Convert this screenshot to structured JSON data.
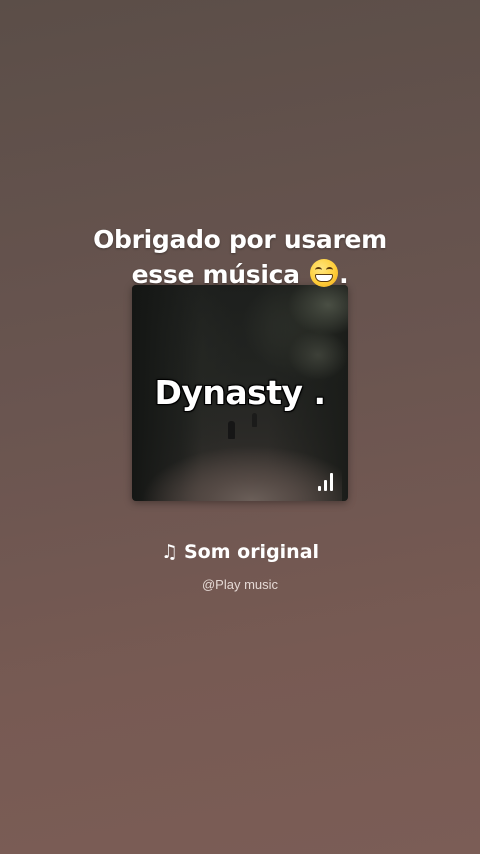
{
  "caption": {
    "line1": "Obrigado por usarem",
    "line2": "esse música",
    "emoji": "grinning-face-emoji",
    "line2_suffix": "."
  },
  "cover": {
    "title": "Dynasty .",
    "bars_icon": "signal-bars-icon"
  },
  "sound": {
    "note_icon": "♫",
    "label": "Som original"
  },
  "author": "@Play music",
  "colors": {
    "background_top": "#5b4e48",
    "background_bottom": "#7b5d56",
    "text": "#ffffff"
  }
}
